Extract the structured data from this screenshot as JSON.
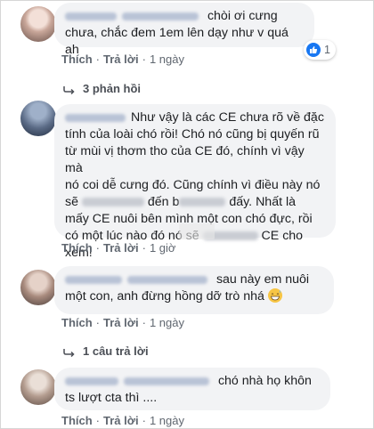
{
  "comments": [
    {
      "text": "chòi ơi cưng chưa, chắc đem 1em lên dạy như v quá ah",
      "like": "Thích",
      "reply": "Trả lời",
      "time": "1 ngày",
      "reaction_count": "1",
      "replies_link": "3 phản hồi"
    },
    {
      "text_lines": [
        "Như vậy là các CE chưa rõ về đặc",
        "tính của loài chó rồi! Chó nó cũng bị quyến rũ",
        "từ mùi vị thơm tho của CE đó, chính vì vậy mà",
        "nó coi dễ cưng đó. Cũng chính vì điều này nó",
        "sẽ",
        "đến b",
        "đấy. Nhất là",
        "mấy CE nuôi bên mình một con chó đực, rồi",
        "có một lúc nào đó nó sẽ",
        "CE cho",
        "xem!"
      ],
      "like": "Thích",
      "reply": "Trả lời",
      "time": "1 giờ"
    },
    {
      "text": "sau này em nuôi một con, anh đừng hồng dỡ trò nhá",
      "like": "Thích",
      "reply": "Trả lời",
      "time": "1 ngày",
      "replies_link": "1 câu trả lời"
    },
    {
      "text": "chó nhà họ khôn ts lượt cta thì ....",
      "like": "Thích",
      "reply": "Trả lời",
      "time": "1 ngày"
    }
  ],
  "colors": {
    "bubble": "#f2f3f5",
    "link_blue": "#1877f2",
    "muted": "#606770"
  },
  "icons": [
    "like-icon",
    "reply-arrow-icon",
    "grin-sweat-emoji-icon"
  ]
}
